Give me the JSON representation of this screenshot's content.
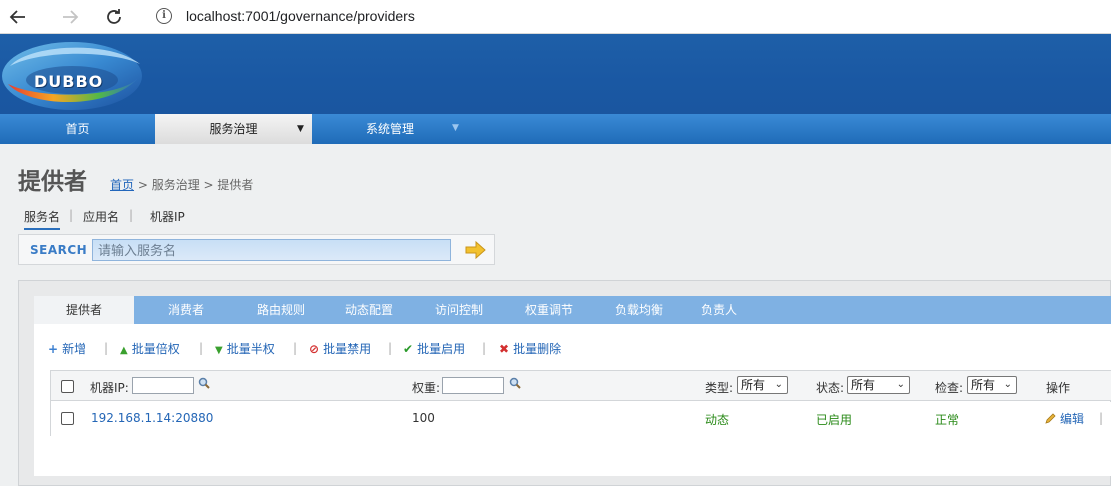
{
  "browser": {
    "url": "localhost:7001/governance/providers",
    "back_icon": "arrow-left-icon",
    "forward_icon": "arrow-right-icon",
    "reload_icon": "reload-icon",
    "info_icon": "info-icon"
  },
  "header": {
    "logo_text": "DUBBO"
  },
  "mainnav": {
    "items": [
      {
        "label": "首页"
      },
      {
        "label": "服务治理"
      },
      {
        "label": "系统管理"
      }
    ]
  },
  "page": {
    "title": "提供者",
    "breadcrumb": {
      "home": "首页",
      "rest": " > 服务治理 > 提供者"
    }
  },
  "search": {
    "tabs": [
      {
        "label": "服务名"
      },
      {
        "label": "应用名"
      },
      {
        "label": "机器IP"
      }
    ],
    "separator": "|",
    "label": "SEARCH",
    "placeholder": "请输入服务名"
  },
  "subtabs": [
    {
      "label": "提供者"
    },
    {
      "label": "消费者"
    },
    {
      "label": "路由规则"
    },
    {
      "label": "动态配置"
    },
    {
      "label": "访问控制"
    },
    {
      "label": "权重调节"
    },
    {
      "label": "负载均衡"
    },
    {
      "label": "负责人"
    }
  ],
  "toolbar": {
    "items": [
      {
        "label": "新增",
        "icon": "+"
      },
      {
        "label": "批量倍权",
        "icon": "▲"
      },
      {
        "label": "批量半权",
        "icon": "▼"
      },
      {
        "label": "批量禁用",
        "icon": "⊘"
      },
      {
        "label": "批量启用",
        "icon": "✔"
      },
      {
        "label": "批量删除",
        "icon": "✖"
      }
    ],
    "separator": "|"
  },
  "table": {
    "headers": {
      "ip": "机器IP:",
      "weight": "权重:",
      "type": "类型:",
      "status": "状态:",
      "check": "检查:",
      "actions": "操作"
    },
    "filters": {
      "type": "所有",
      "status": "所有",
      "check": "所有"
    },
    "rows": [
      {
        "ip": "192.168.1.14:20880",
        "weight": "100",
        "type": "动态",
        "status": "已启用",
        "check": "正常",
        "action": "编辑",
        "separator": "|"
      }
    ]
  },
  "colors": {
    "header_blue": "#1a58a3",
    "nav_blue": "#2a78c8",
    "subtab_blue": "#7fb1e3",
    "link_blue": "#2466b6",
    "ok_green": "#2a8a18"
  }
}
